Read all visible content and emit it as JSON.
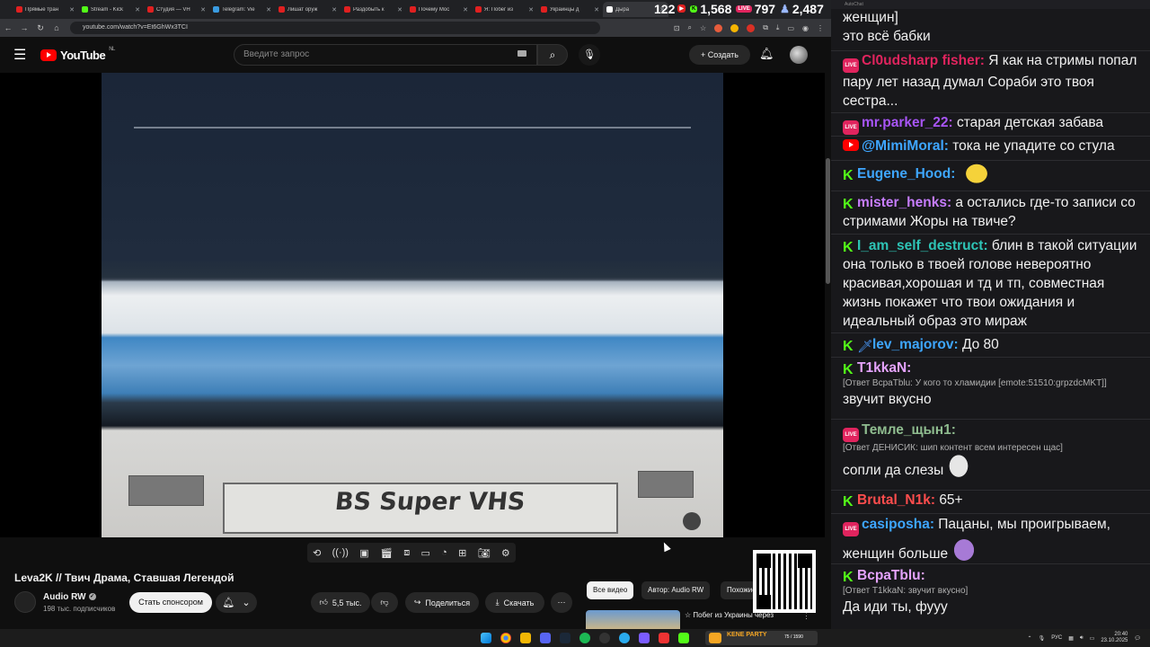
{
  "browser": {
    "tabs": [
      {
        "title": "Прямые тран",
        "color": "#e02020"
      },
      {
        "title": "Stream - Kick",
        "color": "#53fc18"
      },
      {
        "title": "Студия — VH",
        "color": "#e02020"
      },
      {
        "title": "Telegram: Vie",
        "color": "#3a9be0"
      },
      {
        "title": "Лишат оруж",
        "color": "#e02020"
      },
      {
        "title": "Раздобыть к",
        "color": "#e02020"
      },
      {
        "title": "Почему Мос",
        "color": "#e02020"
      },
      {
        "title": "Я: Побег из",
        "color": "#e02020"
      },
      {
        "title": "Украинцы д",
        "color": "#e02020"
      },
      {
        "title": "Дыра",
        "color": "#ffffff"
      }
    ],
    "url": "youtube.com/watch?v=Et6GhWx3TCI"
  },
  "stream_stats": {
    "youtube": "122",
    "kick": "1,568",
    "live": "797",
    "total": "2,487"
  },
  "youtube": {
    "logo_text": "YouTube",
    "region": "NL",
    "search_placeholder": "Введите запрос",
    "create_label": "Создать"
  },
  "video": {
    "vhs_label": "BS Super VHS",
    "title": "Leva2K // Твич Драма, Ставшая Легендой",
    "channel": "Audio RW",
    "subscribers": "198 тыс. подписчиков",
    "sponsor_label": "Стать спонсором",
    "likes": "5,5 тыс.",
    "share_label": "Поделиться",
    "download_label": "Скачать"
  },
  "recommendations": {
    "chips": [
      "Все видео",
      "Автор: Audio RW",
      "Похожие"
    ],
    "next_title": "☆ Побег из Украины через"
  },
  "chat": {
    "app_title": "AutoChat",
    "messages": [
      {
        "id": "m0",
        "platform": "none",
        "user": "",
        "color": "#ffffff",
        "text": "женщин]\nэто всё бабки"
      },
      {
        "id": "m1",
        "platform": "live",
        "user": "Cl0udsharp fisher",
        "color": "#e0245e",
        "text": "Я как на стримы попал пару лет назад думал Сораби это твоя сестра..."
      },
      {
        "id": "m2",
        "platform": "live",
        "user": "mr.parker_22",
        "color": "#a855f7",
        "text": "старая детская забава"
      },
      {
        "id": "m3",
        "platform": "yt",
        "user": "@MimiMoral",
        "color": "#3ea6ff",
        "text": "тока не упадите со стула"
      },
      {
        "id": "m4",
        "platform": "kick",
        "user": "Eugene_Hood",
        "color": "#3ea6ff",
        "text": ""
      },
      {
        "id": "m5",
        "platform": "kick",
        "user": "mister_henks",
        "color": "#c77dff",
        "text": "а остались где-то записи со стримами Жоры на твиче?"
      },
      {
        "id": "m6",
        "platform": "kick",
        "user": "I_am_self_destruct",
        "color": "#2ec4b6",
        "text": "блин в такой ситуации она только в твоей голове невероятно красивая,хорошая и тд и тп, совместная жизнь покажет что твои ожидания и идеальный образ это мираж"
      },
      {
        "id": "m7",
        "platform": "kick",
        "user": "lev_majorov",
        "color": "#3ea6ff",
        "text": "До 80"
      },
      {
        "id": "m8",
        "platform": "kick",
        "user": "T1kkaN",
        "color": "#e5a3ff",
        "reply": "[Ответ BcpaTblu: У кого то хламидии [emote:51510:grpzdcMKT]]",
        "text": "звучит вкусно"
      },
      {
        "id": "m9",
        "platform": "live",
        "user": "Темле_щын1",
        "color": "#8fbc8f",
        "reply": "[Ответ ДЕНИСИК: шип контент всем интересен щас]",
        "text": "сопли да слезы"
      },
      {
        "id": "m10",
        "platform": "kick",
        "user": "Brutal_N1k",
        "color": "#ff4d4d",
        "text": "65+"
      },
      {
        "id": "m11",
        "platform": "live",
        "user": "casiposha",
        "color": "#3ea6ff",
        "text": "Пацаны, мы проигрываем, женщин больше"
      },
      {
        "id": "m12",
        "platform": "kick",
        "user": "BcpaTblu",
        "color": "#e5a3ff",
        "reply": "[Ответ T1kkaN: звучит вкусно]",
        "text": "Да иди ты, фууу"
      }
    ]
  },
  "taskbar": {
    "widget_label": "KENE PARTY",
    "widget_count": "75 / 1590",
    "lang": "РУС",
    "time": "20:40",
    "date": "23.10.2025"
  }
}
